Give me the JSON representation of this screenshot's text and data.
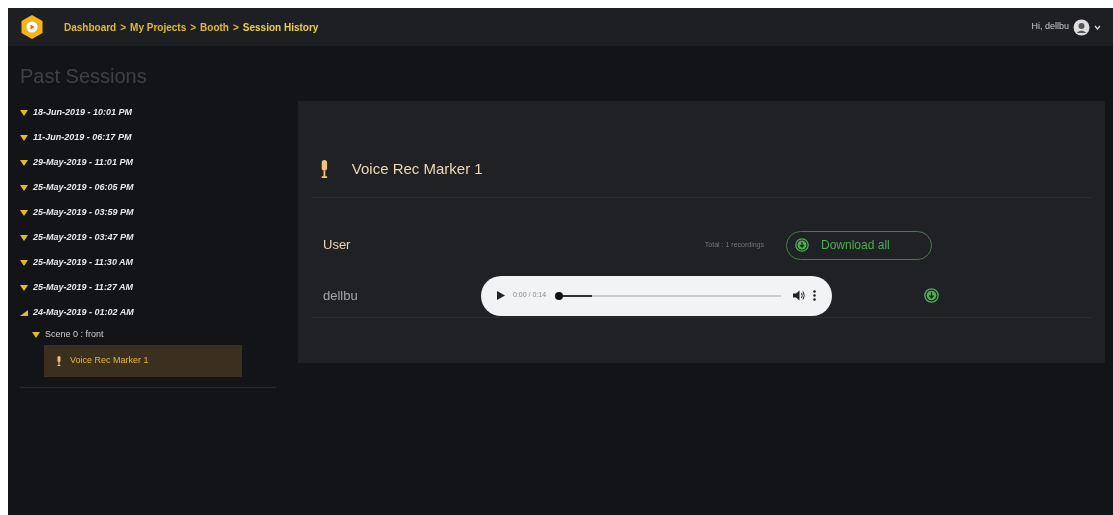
{
  "header": {
    "breadcrumb": [
      "Dashboard",
      "My Projects",
      "Booth",
      "Session History"
    ],
    "separator": ">",
    "greeting": "Hi, dellbu"
  },
  "sidebar": {
    "title": "Past Sessions",
    "sessions": [
      {
        "label": "18-Jun-2019 - 10:01 PM",
        "expanded": false
      },
      {
        "label": "11-Jun-2019 - 06:17 PM",
        "expanded": false
      },
      {
        "label": "29-May-2019 - 11:01 PM",
        "expanded": false
      },
      {
        "label": "25-May-2019 - 06:05 PM",
        "expanded": false
      },
      {
        "label": "25-May-2019 - 03:59 PM",
        "expanded": false
      },
      {
        "label": "25-May-2019 - 03:47 PM",
        "expanded": false
      },
      {
        "label": "25-May-2019 - 11:30 AM",
        "expanded": false
      },
      {
        "label": "25-May-2019 - 11:27 AM",
        "expanded": false
      },
      {
        "label": "24-May-2019 - 01:02 AM",
        "expanded": true,
        "children": [
          {
            "label": "Scene 0 : front",
            "expanded": true,
            "children": [
              {
                "label": "Voice Rec Marker 1",
                "selected": true
              }
            ]
          }
        ]
      }
    ]
  },
  "panel": {
    "title": "Voice Rec Marker 1",
    "column_header": "User",
    "total": "Total : 1 recordings",
    "download_all": "Download all",
    "recordings": [
      {
        "user": "dellbu",
        "time": "0:00 / 0:14",
        "level": 0.15
      }
    ]
  }
}
